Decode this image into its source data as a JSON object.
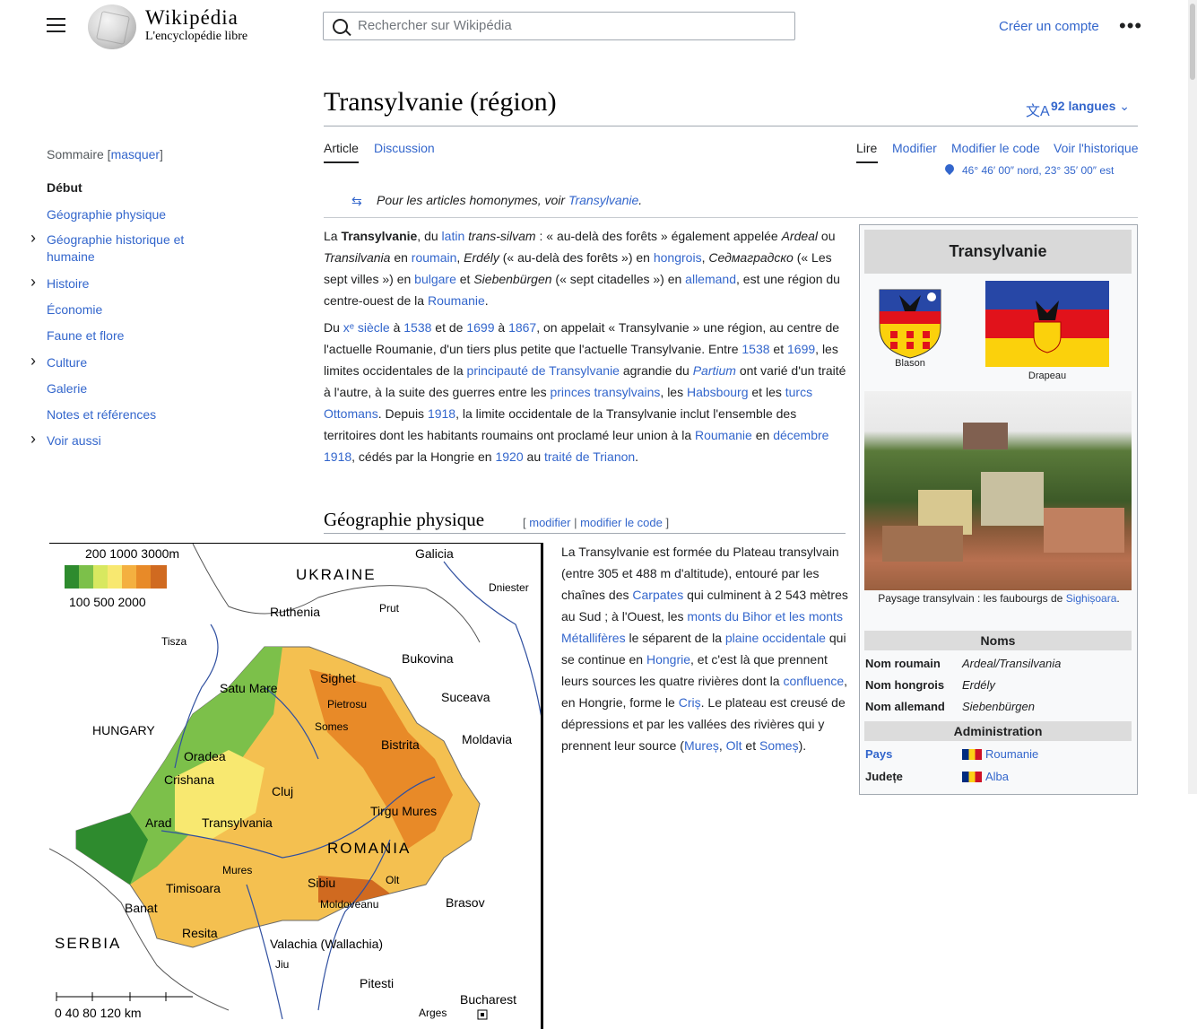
{
  "header": {
    "menu_icon": "hamburger-menu-icon",
    "logo_word": "Wikipédia",
    "tagline": "L'encyclopédie libre",
    "search_placeholder": "Rechercher sur Wikipédia",
    "create_account": "Créer un compte",
    "more": "•••"
  },
  "page": {
    "title": "Transylvanie (région)",
    "languages": "92 langues",
    "tabs_left": [
      "Article",
      "Discussion"
    ],
    "tabs_right": [
      "Lire",
      "Modifier",
      "Modifier le code",
      "Voir l'historique"
    ],
    "coordinates": "46° 46′ 00″ nord, 23° 35′ 00″ est",
    "hatnote_prefix": "Pour les articles homonymes, voir ",
    "hatnote_link": "Transylvanie",
    "hatnote_suffix": "."
  },
  "toc": {
    "heading": "Sommaire",
    "hide": "masquer",
    "items": [
      {
        "label": "Début",
        "current": true,
        "expandable": false
      },
      {
        "label": "Géographie physique",
        "current": false,
        "expandable": false
      },
      {
        "label": "Géographie historique et humaine",
        "current": false,
        "expandable": true
      },
      {
        "label": "Histoire",
        "current": false,
        "expandable": true
      },
      {
        "label": "Économie",
        "current": false,
        "expandable": false
      },
      {
        "label": "Faune et flore",
        "current": false,
        "expandable": false
      },
      {
        "label": "Culture",
        "current": false,
        "expandable": true
      },
      {
        "label": "Galerie",
        "current": false,
        "expandable": false
      },
      {
        "label": "Notes et références",
        "current": false,
        "expandable": false
      },
      {
        "label": "Voir aussi",
        "current": false,
        "expandable": true
      }
    ]
  },
  "intro": {
    "p1": [
      {
        "t": "La "
      },
      {
        "t": "Transylvanie",
        "b": true
      },
      {
        "t": ", du "
      },
      {
        "t": "latin",
        "a": true
      },
      {
        "t": " "
      },
      {
        "t": "trans-silvam",
        "i": true
      },
      {
        "t": " : « au-delà des forêts » également appelée "
      },
      {
        "t": "Ardeal",
        "i": true
      },
      {
        "t": " ou "
      },
      {
        "t": "Transilvania",
        "i": true
      },
      {
        "t": " en "
      },
      {
        "t": "roumain",
        "a": true
      },
      {
        "t": ", "
      },
      {
        "t": "Erdély",
        "i": true
      },
      {
        "t": " (« au-delà des forêts ») en "
      },
      {
        "t": "hongrois",
        "a": true
      },
      {
        "t": ", "
      },
      {
        "t": "Седмаградско",
        "i": true
      },
      {
        "t": " (« Les sept villes ») en "
      },
      {
        "t": "bulgare",
        "a": true
      },
      {
        "t": " et "
      },
      {
        "t": "Siebenbürgen",
        "i": true
      },
      {
        "t": " (« sept citadelles ») en "
      },
      {
        "t": "allemand",
        "a": true
      },
      {
        "t": ", est une région du centre-ouest de la "
      },
      {
        "t": "Roumanie",
        "a": true
      },
      {
        "t": "."
      }
    ],
    "p2": [
      {
        "t": "Du "
      },
      {
        "t": "xᵉ siècle",
        "a": true
      },
      {
        "t": " à "
      },
      {
        "t": "1538",
        "a": true
      },
      {
        "t": " et de "
      },
      {
        "t": "1699",
        "a": true
      },
      {
        "t": " à "
      },
      {
        "t": "1867",
        "a": true
      },
      {
        "t": ", on appelait « Transylvanie » une région, au centre de l'actuelle Roumanie, d'un tiers plus petite que l'actuelle Transylvanie. Entre "
      },
      {
        "t": "1538",
        "a": true
      },
      {
        "t": " et "
      },
      {
        "t": "1699",
        "a": true
      },
      {
        "t": ", les limites occidentales de la "
      },
      {
        "t": "principauté de Transylvanie",
        "a": true
      },
      {
        "t": " agrandie du "
      },
      {
        "t": "Partium",
        "a": true,
        "i": true
      },
      {
        "t": " ont varié d'un traité à l'autre, à la suite des guerres entre les "
      },
      {
        "t": "princes transylvains",
        "a": true
      },
      {
        "t": ", les "
      },
      {
        "t": "Habsbourg",
        "a": true
      },
      {
        "t": " et les "
      },
      {
        "t": "turcs Ottomans",
        "a": true
      },
      {
        "t": ". Depuis "
      },
      {
        "t": "1918",
        "a": true
      },
      {
        "t": ", la limite occidentale de la Transylvanie inclut l'ensemble des territoires dont les habitants roumains ont proclamé leur union à la "
      },
      {
        "t": "Roumanie",
        "a": true
      },
      {
        "t": " en "
      },
      {
        "t": "décembre 1918",
        "a": true
      },
      {
        "t": ", cédés par la Hongrie en "
      },
      {
        "t": "1920",
        "a": true
      },
      {
        "t": " au "
      },
      {
        "t": "traité de Trianon",
        "a": true
      },
      {
        "t": "."
      }
    ]
  },
  "section_geo": {
    "title": "Géographie physique",
    "edit_open": "[ ",
    "edit_modifier": "modifier",
    "edit_sep": " | ",
    "edit_code": "modifier le code",
    "edit_close": " ]",
    "p": [
      {
        "t": "La Transylvanie est formée du Plateau transylvain (entre 305 et 488 m d'altitude), entouré par les chaînes des "
      },
      {
        "t": "Carpates",
        "a": true
      },
      {
        "t": " qui culminent à 2 543 mètres au Sud ; à l'Ouest, les "
      },
      {
        "t": "monts du Bihor et les monts Métallifères",
        "a": true
      },
      {
        "t": " le séparent de la "
      },
      {
        "t": "plaine occidentale",
        "a": true
      },
      {
        "t": " qui se continue en "
      },
      {
        "t": "Hongrie",
        "a": true
      },
      {
        "t": ", et c'est là que prennent leurs sources les quatre rivières dont la "
      },
      {
        "t": "confluence",
        "a": true
      },
      {
        "t": ", en Hongrie, forme le "
      },
      {
        "t": "Criș",
        "a": true
      },
      {
        "t": ". Le plateau est creusé de dépressions et par les vallées des rivières qui y prennent leur source ("
      },
      {
        "t": "Mureș",
        "a": true
      },
      {
        "t": ", "
      },
      {
        "t": "Olt",
        "a": true
      },
      {
        "t": " et "
      },
      {
        "t": "Someș",
        "a": true
      },
      {
        "t": ")."
      }
    ]
  },
  "infobox": {
    "title": "Transylvanie",
    "coat_caption": "Blason",
    "flag_caption": "Drapeau",
    "photo_caption": "Paysage transylvain : les faubourgs de ",
    "photo_caption_link": "Sighișoara",
    "photo_caption_end": ".",
    "section_names": "Noms",
    "rows_names": [
      {
        "label": "Nom roumain",
        "value": "Ardeal/Transilvania"
      },
      {
        "label": "Nom hongrois",
        "value": "Erdély"
      },
      {
        "label": "Nom allemand",
        "value": "Siebenbürgen"
      }
    ],
    "section_admin": "Administration",
    "rows_admin": [
      {
        "label": "Pays",
        "value": "Roumanie",
        "link_label": true
      },
      {
        "label": "Județe",
        "value": "Alba",
        "link_label": false
      }
    ],
    "flag_colors": [
      "#2747a6",
      "#e1121b",
      "#fbd10c"
    ]
  },
  "map": {
    "legend_top": "200  1000  3000m",
    "legend_bottom": "100   500   2000",
    "legend_colors": [
      "#2e8b2e",
      "#7cc04a",
      "#d8e860",
      "#f8e870",
      "#f4b040",
      "#e88a28",
      "#d06a20"
    ],
    "scale": "0      40      80    120 km",
    "labels": [
      {
        "t": "UKRAINE",
        "cls": "big"
      },
      {
        "t": "Galicia"
      },
      {
        "t": "Dniester",
        "cls": "sm"
      },
      {
        "t": "Ruthenia"
      },
      {
        "t": "Prut",
        "cls": "sm"
      },
      {
        "t": "Tisza",
        "cls": "sm"
      },
      {
        "t": "Bukovina"
      },
      {
        "t": "Sighet"
      },
      {
        "t": "Satu Mare"
      },
      {
        "t": "Pietrosu",
        "cls": "sm"
      },
      {
        "t": "Suceava"
      },
      {
        "t": "HUNGARY"
      },
      {
        "t": "Somes",
        "cls": "sm"
      },
      {
        "t": "Moldavia"
      },
      {
        "t": "Oradea"
      },
      {
        "t": "Bistrita"
      },
      {
        "t": "Crishana"
      },
      {
        "t": "Cluj"
      },
      {
        "t": "Tirgu Mures"
      },
      {
        "t": "Arad"
      },
      {
        "t": "Transylvania"
      },
      {
        "t": "ROMANIA",
        "cls": "big"
      },
      {
        "t": "Mures",
        "cls": "sm"
      },
      {
        "t": "Sibiu"
      },
      {
        "t": "Olt",
        "cls": "sm"
      },
      {
        "t": "Timisoara"
      },
      {
        "t": "Moldoveanu",
        "cls": "sm"
      },
      {
        "t": "Brasov"
      },
      {
        "t": "Banat"
      },
      {
        "t": "Resita"
      },
      {
        "t": "SERBIA",
        "cls": "big"
      },
      {
        "t": "Valachia (Wallachia)"
      },
      {
        "t": "Jiu",
        "cls": "sm"
      },
      {
        "t": "Pitesti"
      },
      {
        "t": "Bucharest"
      },
      {
        "t": "Arges",
        "cls": "sm"
      }
    ]
  }
}
